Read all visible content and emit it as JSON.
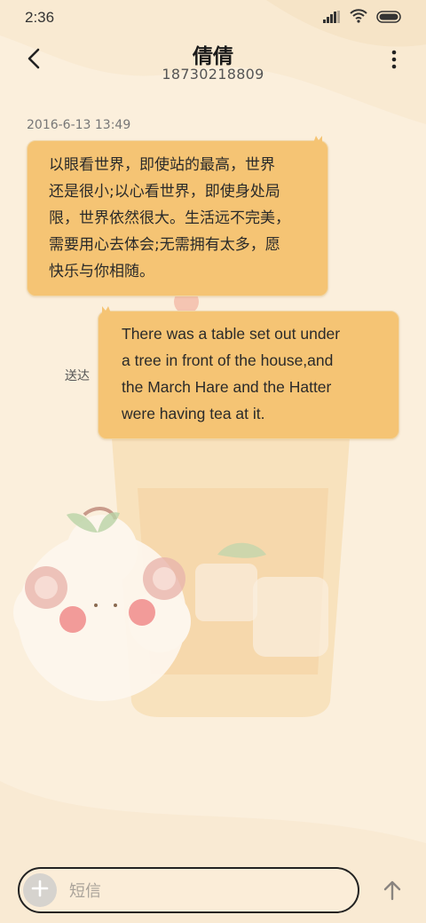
{
  "status_bar": {
    "time": "2:36",
    "icons": [
      "signal-icon",
      "wifi-icon",
      "battery-icon"
    ]
  },
  "header": {
    "contact_name": "倩倩",
    "phone_number": "18730218809",
    "back_icon": "chevron-left-icon",
    "more_icon": "more-vertical-icon"
  },
  "conversation": {
    "timestamp": "2016-6-13 13:49",
    "messages": [
      {
        "direction": "incoming",
        "lines": [
          "以眼看世界，即使站的最高，世界",
          "还是很小;以心看世界，即使身处局",
          "限，世界依然很大。生活远不完美，",
          "需要用心去体会;无需拥有太多，愿",
          "快乐与你相随。"
        ]
      },
      {
        "direction": "outgoing",
        "status": "送达",
        "lines": [
          "There was a table set out under",
          "a tree in front of the house,and",
          "the March Hare and the Hatter",
          "were having tea at it."
        ]
      }
    ]
  },
  "compose": {
    "placeholder": "短信",
    "attach_icon": "plus-icon",
    "send_icon": "arrow-up-icon"
  },
  "colors": {
    "background": "#fbefdc",
    "bubble": "#f5c474",
    "text": "#222222"
  }
}
